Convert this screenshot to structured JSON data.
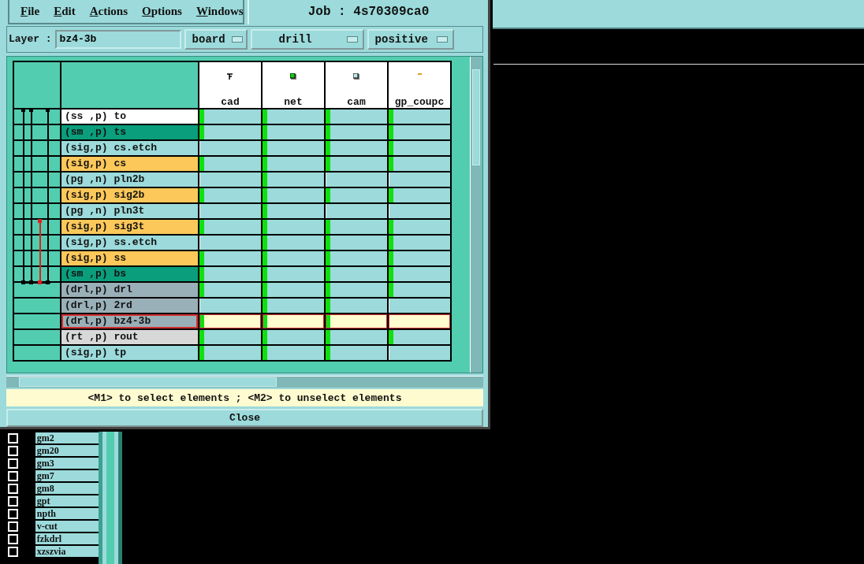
{
  "menu": [
    {
      "label": "File"
    },
    {
      "label": "Edit"
    },
    {
      "label": "Actions"
    },
    {
      "label": "Options"
    },
    {
      "label": "Windows"
    }
  ],
  "job_title": "Job : 4s70309ca0",
  "layer_field": {
    "label": "Layer :",
    "value": "bz4-3b"
  },
  "dropdowns": [
    "board",
    "drill",
    "positive"
  ],
  "matrix": {
    "columns": [
      "cad",
      "net",
      "cam",
      "gp_coupc"
    ],
    "rows": [
      {
        "label": "(ss ,p) to",
        "color": "#ffffff",
        "selected": false,
        "cells": [
          {
            "on": true
          },
          {
            "on": true
          },
          {
            "on": true
          },
          {
            "on": true
          }
        ]
      },
      {
        "label": "(sm ,p) ts",
        "color": "#0a9e7c",
        "selected": false,
        "cells": [
          {
            "on": true
          },
          {
            "on": true
          },
          {
            "on": true
          },
          {
            "on": true
          }
        ]
      },
      {
        "label": "(sig,p) cs.etch",
        "color": "#9cdadb",
        "selected": false,
        "cells": [
          {
            "on": false
          },
          {
            "on": true
          },
          {
            "on": true
          },
          {
            "on": true
          }
        ]
      },
      {
        "label": "(sig,p) cs",
        "color": "#fcc85a",
        "selected": false,
        "cells": [
          {
            "on": true
          },
          {
            "on": true
          },
          {
            "on": true
          },
          {
            "on": true
          }
        ]
      },
      {
        "label": "(pg ,n) pln2b",
        "color": "#9cdadb",
        "selected": false,
        "cells": [
          {
            "on": false
          },
          {
            "on": true
          },
          {
            "on": false
          },
          {
            "on": false
          }
        ]
      },
      {
        "label": "(sig,p) sig2b",
        "color": "#fcc85a",
        "selected": false,
        "cells": [
          {
            "on": true
          },
          {
            "on": true
          },
          {
            "on": true
          },
          {
            "on": true
          }
        ]
      },
      {
        "label": "(pg ,n) pln3t",
        "color": "#9cdadb",
        "selected": false,
        "cells": [
          {
            "on": false
          },
          {
            "on": true
          },
          {
            "on": false
          },
          {
            "on": false
          }
        ]
      },
      {
        "label": "(sig,p) sig3t",
        "color": "#fcc85a",
        "selected": false,
        "cells": [
          {
            "on": true
          },
          {
            "on": true
          },
          {
            "on": true
          },
          {
            "on": true
          }
        ]
      },
      {
        "label": "(sig,p) ss.etch",
        "color": "#9cdadb",
        "selected": false,
        "cells": [
          {
            "on": false
          },
          {
            "on": true
          },
          {
            "on": true
          },
          {
            "on": true
          }
        ]
      },
      {
        "label": "(sig,p) ss",
        "color": "#fcc85a",
        "selected": false,
        "cells": [
          {
            "on": true
          },
          {
            "on": true
          },
          {
            "on": true
          },
          {
            "on": true
          }
        ]
      },
      {
        "label": "(sm ,p) bs",
        "color": "#0a9e7c",
        "selected": false,
        "cells": [
          {
            "on": true
          },
          {
            "on": true
          },
          {
            "on": true
          },
          {
            "on": true
          }
        ]
      },
      {
        "label": "(drl,p) drl",
        "color": "#9ab0b8",
        "selected": false,
        "cells": [
          {
            "on": true
          },
          {
            "on": true
          },
          {
            "on": true
          },
          {
            "on": true
          }
        ]
      },
      {
        "label": "(drl,p) 2rd",
        "color": "#9ab0b8",
        "selected": false,
        "cells": [
          {
            "on": false
          },
          {
            "on": true
          },
          {
            "on": true
          },
          {
            "on": false
          }
        ]
      },
      {
        "label": "(drl,p) bz4-3b",
        "color": "#9ab0b8",
        "selected": true,
        "cells": [
          {
            "on": true
          },
          {
            "on": true
          },
          {
            "on": true
          },
          {
            "on": false
          }
        ]
      },
      {
        "label": "(rt ,p) rout",
        "color": "#d8d8d8",
        "selected": false,
        "cells": [
          {
            "on": true
          },
          {
            "on": true
          },
          {
            "on": true
          },
          {
            "on": true
          }
        ]
      },
      {
        "label": "(sig,p) tp",
        "color": "#9cdadb",
        "selected": false,
        "cells": [
          {
            "on": true
          },
          {
            "on": true
          },
          {
            "on": true
          },
          {
            "on": false
          }
        ]
      }
    ]
  },
  "status_message": "<M1> to select elements ; <M2> to unselect elements",
  "close_button": "Close",
  "background_list": [
    {
      "label": "gm2",
      "checked": false
    },
    {
      "label": "gm20",
      "checked": false
    },
    {
      "label": "gm3",
      "checked": false
    },
    {
      "label": "gm7",
      "checked": false
    },
    {
      "label": "gm8",
      "checked": false
    },
    {
      "label": "gpt",
      "checked": false
    },
    {
      "label": "npth",
      "checked": false
    },
    {
      "label": "v-cut",
      "checked": false
    },
    {
      "label": "fzkdrl",
      "checked": false
    },
    {
      "label": "xzszvia",
      "checked": false
    }
  ]
}
